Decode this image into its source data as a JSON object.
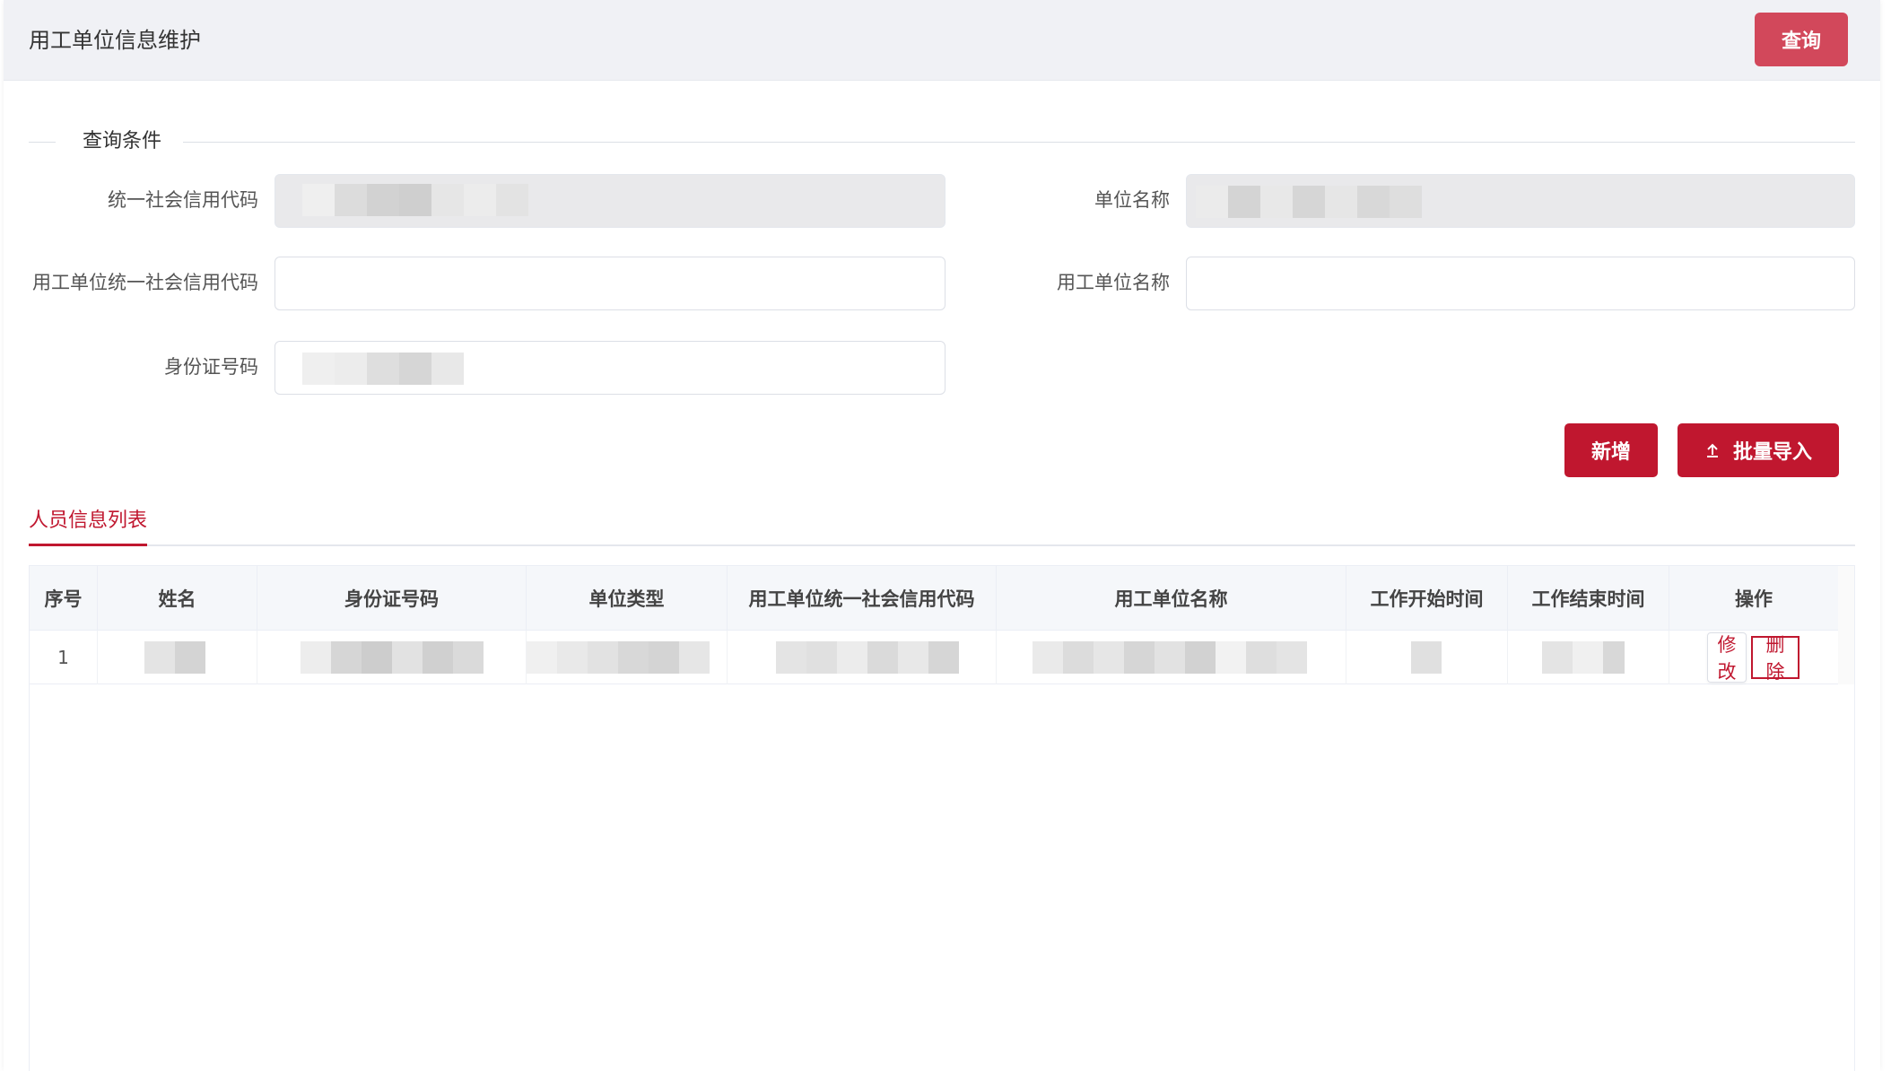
{
  "header": {
    "title": "用工单位信息维护",
    "query_button": "查询"
  },
  "query_section": {
    "legend": "查询条件",
    "fields": {
      "credit_code": {
        "label": "统一社会信用代码",
        "value": "",
        "disabled": true
      },
      "unit_name": {
        "label": "单位名称",
        "value": "",
        "disabled": true
      },
      "employer_credit_code": {
        "label": "用工单位统一社会信用代码",
        "value": ""
      },
      "employer_name": {
        "label": "用工单位名称",
        "value": ""
      },
      "id_number": {
        "label": "身份证号码",
        "value": ""
      }
    }
  },
  "actions": {
    "add": "新增",
    "batch_import": "批量导入",
    "upload_icon": "upload-icon"
  },
  "tabs": [
    {
      "label": "人员信息列表",
      "active": true
    }
  ],
  "table": {
    "columns": [
      "序号",
      "姓名",
      "身份证号码",
      "单位类型",
      "用工单位统一社会信用代码",
      "用工单位名称",
      "工作开始时间",
      "工作结束时间",
      "操作"
    ],
    "rows": [
      {
        "index": "1",
        "edit": "修改",
        "delete": "删除"
      }
    ]
  },
  "colors": {
    "primary": "#c0172f",
    "query_button": "#d2485b",
    "header_bg": "#f0f1f5"
  }
}
